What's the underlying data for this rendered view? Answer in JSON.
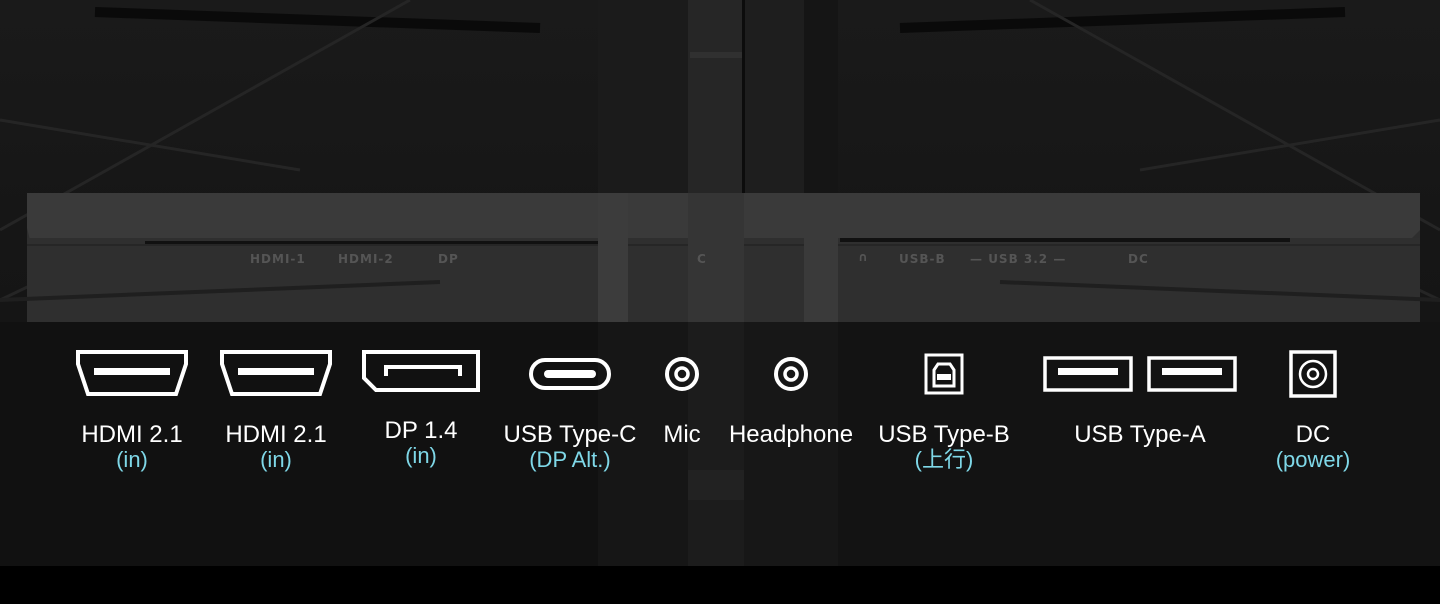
{
  "panel_silkscreen": {
    "hdmi1": "HDMI-1",
    "hdmi2": "HDMI-2",
    "dp": "DP",
    "usbc_mark": "C",
    "headphone_mark": "∩",
    "usbb": "USB-B",
    "usb32": "USB 3.2",
    "dc": "DC"
  },
  "ports": [
    {
      "icon": "hdmi-port-icon",
      "label": "HDMI 2.1",
      "sub": "(in)"
    },
    {
      "icon": "hdmi-port-icon",
      "label": "HDMI 2.1",
      "sub": "(in)"
    },
    {
      "icon": "displayport-icon",
      "label": "DP 1.4",
      "sub": "(in)"
    },
    {
      "icon": "usb-c-port-icon",
      "label": "USB Type-C",
      "sub": "(DP Alt.)"
    },
    {
      "icon": "mic-jack-icon",
      "label": "Mic",
      "sub": ""
    },
    {
      "icon": "headphone-jack-icon",
      "label": "Headphone",
      "sub": ""
    },
    {
      "icon": "usb-b-port-icon",
      "label": "USB Type-B",
      "sub": "(上行)"
    },
    {
      "icon": "usb-a-port-icon",
      "label": "USB Type-A",
      "sub": ""
    },
    {
      "icon": "dc-power-port-icon",
      "label": "DC",
      "sub": "(power)"
    }
  ],
  "colors": {
    "label": "#ffffff",
    "sublabel": "#7fd8e8",
    "background": "#000000"
  }
}
